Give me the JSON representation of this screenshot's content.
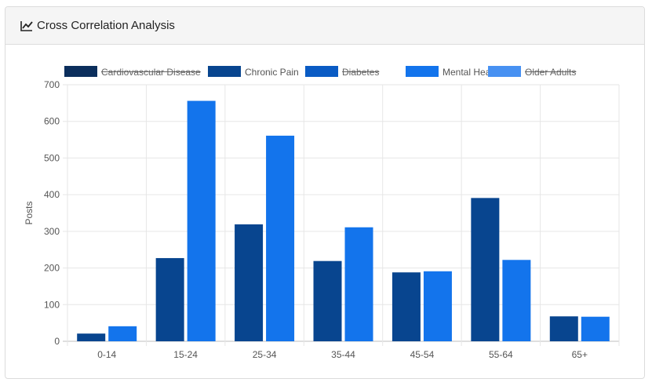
{
  "header": {
    "title": "Cross Correlation Analysis",
    "icon": "line-chart-icon"
  },
  "chart_data": {
    "type": "bar",
    "categories": [
      "0-14",
      "15-24",
      "25-34",
      "35-44",
      "45-54",
      "55-64",
      "65+"
    ],
    "ylabel": "Posts",
    "xlabel": "",
    "ylim": [
      0,
      700
    ],
    "yticks": [
      0,
      100,
      200,
      300,
      400,
      500,
      600,
      700
    ],
    "grid": true,
    "legend_position": "top",
    "legend": [
      {
        "name": "Cardiovascular Disease",
        "color": "#0b2e5c",
        "hidden": true
      },
      {
        "name": "Chronic Pain",
        "color": "#08458f",
        "hidden": false
      },
      {
        "name": "Diabetes",
        "color": "#0a5bc4",
        "hidden": true
      },
      {
        "name": "Mental Health",
        "color": "#1374ec",
        "hidden": false
      },
      {
        "name": "Older Adults",
        "color": "#4791f2",
        "hidden": true
      }
    ],
    "series": [
      {
        "name": "Chronic Pain",
        "color": "#08458f",
        "values": [
          21,
          227,
          319,
          219,
          188,
          391,
          68
        ]
      },
      {
        "name": "Mental Health",
        "color": "#1374ec",
        "values": [
          41,
          656,
          561,
          311,
          191,
          222,
          67
        ]
      }
    ]
  }
}
